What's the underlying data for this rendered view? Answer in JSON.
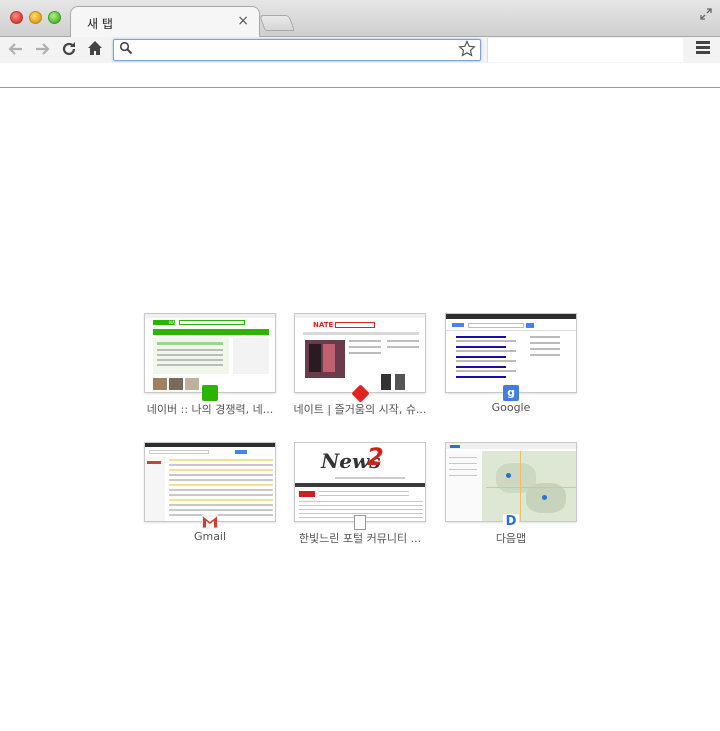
{
  "browser": {
    "tab_title": "새 탭",
    "tab_close_glyph": "×",
    "omnibox_value": "",
    "omnibox_placeholder": ""
  },
  "icons": {
    "back": "back-arrow-icon",
    "forward": "forward-arrow-icon",
    "reload": "reload-icon",
    "home": "home-icon",
    "search": "search-icon",
    "bookmark": "star-icon",
    "menu": "hamburger-menu-icon",
    "fullscreen": "fullscreen-icon"
  },
  "most_visited": [
    {
      "title": "네이버 :: 나의 경쟁력, 네...",
      "favicon_color": "#2db400",
      "site": "naver"
    },
    {
      "title": "네이트 | 즐거움의 시작, 슈...",
      "favicon_color": "#e0231f",
      "site": "nate"
    },
    {
      "title": "Google",
      "favicon_color": "#3f7fe0",
      "site": "google"
    },
    {
      "title": "Gmail",
      "favicon_color": "#d23f31",
      "site": "gmail"
    },
    {
      "title": "한빛느린 포털 커뮤니티 ...",
      "favicon_color": "#bfbfbf",
      "site": "news2"
    },
    {
      "title": "다음맵",
      "favicon_color": "#2c6fd6",
      "site": "daum-map"
    }
  ],
  "thumb_text": {
    "naver_logo": "NAVER",
    "nate_logo": "NATE",
    "news_logo": "News",
    "news_digit": "2"
  }
}
